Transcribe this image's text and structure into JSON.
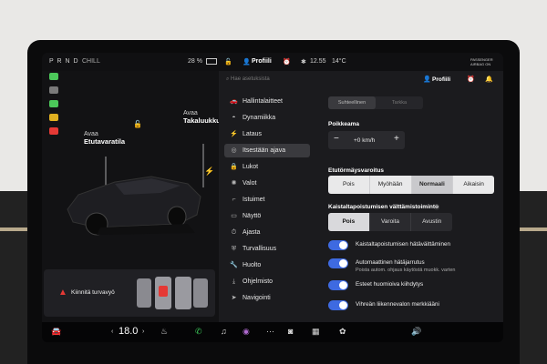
{
  "status_bar": {
    "gears": "P R N D",
    "drive_mode": "CHILL",
    "battery": "28 %",
    "profile": "Profiili",
    "time": "12.55",
    "temperature": "14°C",
    "passenger_airbag": "PASSENGER AIRBAG ON"
  },
  "car_view": {
    "frunk_label": "Avaa",
    "frunk_name": "Etutavaratila",
    "trunk_label": "Avaa",
    "trunk_name": "Takaluukku",
    "alert_text": "Kiinnitä turvavyö",
    "telltale_colors": [
      "#4cc85a",
      "#7a7a7a",
      "#4cc85a",
      "#e0b020",
      "#e53935"
    ]
  },
  "menu": {
    "search_placeholder": "Hae asetuksista",
    "items": [
      {
        "icon": "car-icon",
        "label": "Hallintalaitteet"
      },
      {
        "icon": "car-dynamics-icon",
        "label": "Dynamiikka"
      },
      {
        "icon": "lightning-icon",
        "label": "Lataus"
      },
      {
        "icon": "steering-wheel-icon",
        "label": "Itsestään ajava",
        "selected": true
      },
      {
        "icon": "lock-icon",
        "label": "Lukot"
      },
      {
        "icon": "light-icon",
        "label": "Valot"
      },
      {
        "icon": "seat-icon",
        "label": "Istuimet"
      },
      {
        "icon": "display-icon",
        "label": "Näyttö"
      },
      {
        "icon": "drive-icon",
        "label": "Ajasta"
      },
      {
        "icon": "shield-icon",
        "label": "Turvallisuus"
      },
      {
        "icon": "wrench-icon",
        "label": "Huolto"
      },
      {
        "icon": "download-icon",
        "label": "Ohjelmisto"
      },
      {
        "icon": "navigation-icon",
        "label": "Navigointi"
      }
    ]
  },
  "settings": {
    "header_profile": "Profiili",
    "top_tabs": [
      "Suhteellinen",
      "Tarkka"
    ],
    "offset_title": "Poikkeama",
    "offset_value": "+0 km/h",
    "fcw_title": "Etutörmäysvaroitus",
    "fcw_options": [
      "Pois",
      "Myöhään",
      "Normaali",
      "Aikaisin"
    ],
    "fcw_selected": 2,
    "lda_title": "Kaistaltapoistumisen välttämistoiminto",
    "lda_options": [
      "Pois",
      "Varoita",
      "Avustin"
    ],
    "lda_selected": 0,
    "toggles": [
      {
        "label": "Kaistaltapoistumisen hätäväittäminen",
        "sub": ""
      },
      {
        "label": "Automaattinen hätäjarrutus",
        "sub": "Poista autom. ohjaus käytöstä muokk. varten"
      },
      {
        "label": "Esteet huomioiva kiihdytys",
        "sub": ""
      },
      {
        "label": "Vihreän liikennevalon merkkiääni",
        "sub": ""
      }
    ]
  },
  "dock": {
    "temperature": "18.0",
    "volume_icon": "volume-icon"
  },
  "colors": {
    "accent": "#3e6ae1",
    "alert_red": "#e53935"
  }
}
